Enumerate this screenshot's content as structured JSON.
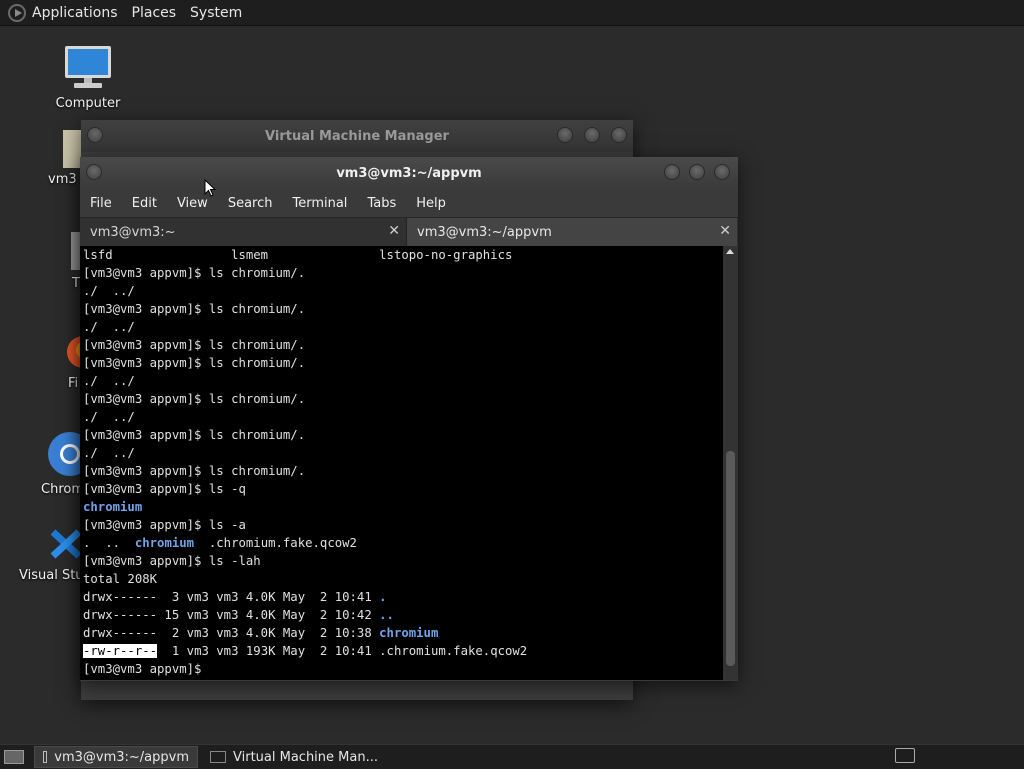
{
  "top_panel": {
    "menus": [
      "Applications",
      "Places",
      "System"
    ]
  },
  "desktop": {
    "icons": [
      {
        "label": "Computer",
        "icon": "computer-icon"
      },
      {
        "label": "vm3",
        "icon": "home-folder-icon"
      },
      {
        "label": "T",
        "icon": "trash-icon"
      },
      {
        "label": "Fi",
        "icon": "firefox-icon"
      },
      {
        "label": "Chrom",
        "icon": "chromium-icon"
      },
      {
        "label": "Visual Stud",
        "icon": "vscode-icon"
      }
    ]
  },
  "vmm_window": {
    "title": "Virtual Machine Manager"
  },
  "terminal_window": {
    "title": "vm3@vm3:~/appvm",
    "menus": [
      "File",
      "Edit",
      "View",
      "Search",
      "Terminal",
      "Tabs",
      "Help"
    ],
    "tabs": [
      {
        "label": "vm3@vm3:~",
        "active": false
      },
      {
        "label": "vm3@vm3:~/appvm",
        "active": true
      }
    ],
    "lines": [
      [
        {
          "t": "lsfd                lsmem               lstopo-no-graphics"
        }
      ],
      [
        {
          "t": "[vm3@vm3 appvm]$ ls chromium/."
        }
      ],
      [
        {
          "t": "./  ../"
        }
      ],
      [
        {
          "t": "[vm3@vm3 appvm]$ ls chromium/."
        }
      ],
      [
        {
          "t": "./  ../"
        }
      ],
      [
        {
          "t": "[vm3@vm3 appvm]$ ls chromium/."
        }
      ],
      [
        {
          "t": "[vm3@vm3 appvm]$ ls chromium/."
        }
      ],
      [
        {
          "t": "./  ../"
        }
      ],
      [
        {
          "t": "[vm3@vm3 appvm]$ ls chromium/."
        }
      ],
      [
        {
          "t": "./  ../"
        }
      ],
      [
        {
          "t": "[vm3@vm3 appvm]$ ls chromium/."
        }
      ],
      [
        {
          "t": "./  ../"
        }
      ],
      [
        {
          "t": "[vm3@vm3 appvm]$ ls chromium/."
        }
      ],
      [
        {
          "t": "[vm3@vm3 appvm]$ ls -q"
        }
      ],
      [
        {
          "t": "chromium",
          "c": "dir"
        }
      ],
      [
        {
          "t": "[vm3@vm3 appvm]$ ls -a"
        }
      ],
      [
        {
          "t": ".  ..  "
        },
        {
          "t": "chromium",
          "c": "dir"
        },
        {
          "t": "  .chromium.fake.qcow2"
        }
      ],
      [
        {
          "t": "[vm3@vm3 appvm]$ ls -lah"
        }
      ],
      [
        {
          "t": "total 208K"
        }
      ],
      [
        {
          "t": "drwx------  3 vm3 vm3 4.0K May  2 10:41 "
        },
        {
          "t": ".",
          "c": "dir"
        }
      ],
      [
        {
          "t": "drwx------ 15 vm3 vm3 4.0K May  2 10:42 "
        },
        {
          "t": "..",
          "c": "dir"
        }
      ],
      [
        {
          "t": "drwx------  2 vm3 vm3 4.0K May  2 10:38 "
        },
        {
          "t": "chromium",
          "c": "dir"
        }
      ],
      [
        {
          "t": "-rw-r--r--",
          "c": "hl"
        },
        {
          "t": "  1 vm3 vm3 193K May  2 10:41 .chromium.fake.qcow2"
        }
      ],
      [
        {
          "t": "[vm3@vm3 appvm]$ "
        }
      ]
    ]
  },
  "taskbar": {
    "tasks": [
      {
        "label": "vm3@vm3:~/appvm",
        "active": true
      },
      {
        "label": "Virtual Machine Man...",
        "active": false
      }
    ]
  }
}
